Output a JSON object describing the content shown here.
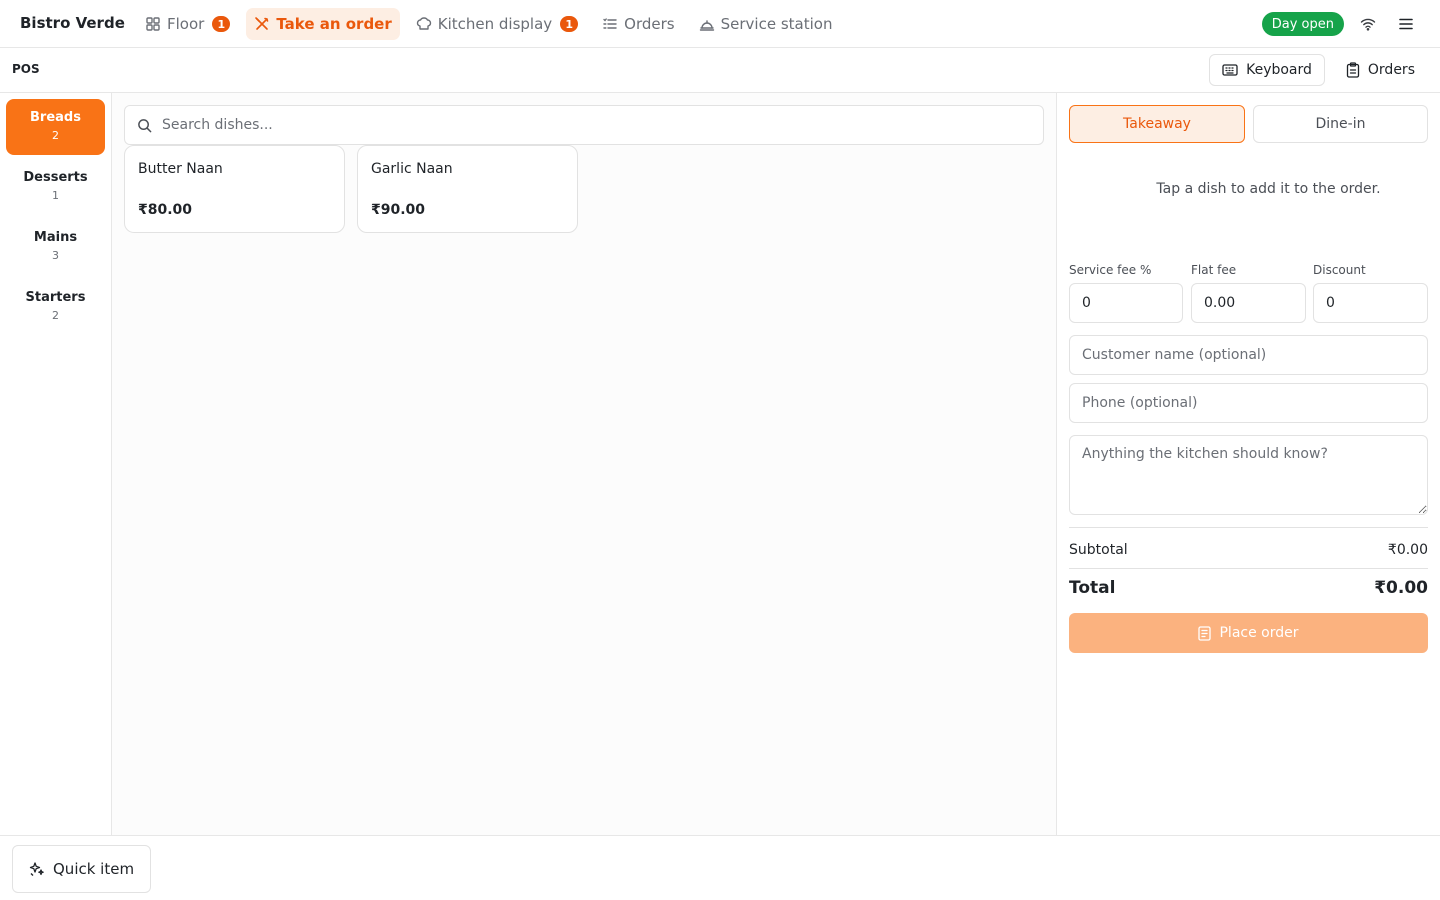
{
  "brand": "Bistro Verde",
  "nav": [
    {
      "label": "Floor",
      "icon": "grid-icon",
      "badge": "1",
      "active": false
    },
    {
      "label": "Take an order",
      "icon": "utensils-icon",
      "active": true
    },
    {
      "label": "Kitchen display",
      "icon": "chef-hat-icon",
      "badge": "1",
      "active": false
    },
    {
      "label": "Orders",
      "icon": "list-icon",
      "active": false
    },
    {
      "label": "Service station",
      "icon": "cloche-icon",
      "active": false
    }
  ],
  "status": {
    "day_label": "Day open"
  },
  "subbar": {
    "title": "POS",
    "keyboard_label": "Keyboard",
    "orders_label": "Orders"
  },
  "categories": [
    {
      "name": "Breads",
      "count": "2",
      "active": true
    },
    {
      "name": "Desserts",
      "count": "1",
      "active": false
    },
    {
      "name": "Mains",
      "count": "3",
      "active": false
    },
    {
      "name": "Starters",
      "count": "2",
      "active": false
    }
  ],
  "search": {
    "placeholder": "Search dishes...",
    "value": ""
  },
  "dishes": [
    {
      "name": "Butter Naan",
      "price": "₹80.00"
    },
    {
      "name": "Garlic Naan",
      "price": "₹90.00"
    }
  ],
  "order": {
    "modes": [
      {
        "label": "Takeaway",
        "active": true
      },
      {
        "label": "Dine-in",
        "active": false
      }
    ],
    "empty_hint": "Tap a dish to add it to the order.",
    "service_fee_label": "Service fee %",
    "service_fee_value": "0",
    "flat_fee_label": "Flat fee",
    "flat_fee_value": "0.00",
    "discount_label": "Discount",
    "discount_value": "0",
    "customer_placeholder": "Customer name (optional)",
    "phone_placeholder": "Phone (optional)",
    "notes_placeholder": "Anything the kitchen should know?",
    "subtotal_label": "Subtotal",
    "subtotal_value": "₹0.00",
    "total_label": "Total",
    "total_value": "₹0.00",
    "place_label": "Place order"
  },
  "bottom": {
    "quick_item_label": "Quick item"
  },
  "colors": {
    "accent": "#f97316",
    "accent_dark": "#ea580c",
    "accent_soft": "#fdeee3",
    "status_green": "#16a34a",
    "disabled_accent": "#fbb27f"
  }
}
